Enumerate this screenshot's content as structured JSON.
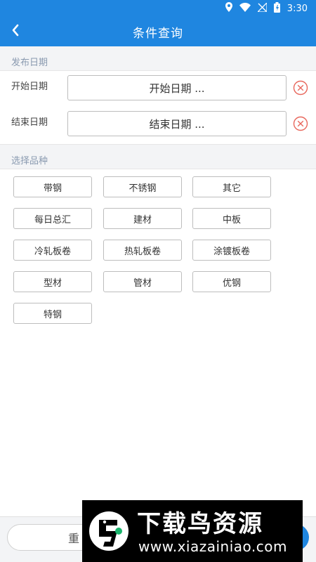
{
  "status_bar": {
    "time": "3:30",
    "icons": [
      "location-icon",
      "wifi-icon",
      "no-signal-icon",
      "battery-icon"
    ]
  },
  "app_bar": {
    "title": "条件查询",
    "back_icon": "chevron-left-icon"
  },
  "date_section": {
    "header": "发布日期",
    "start_label": "开始日期",
    "start_placeholder": "开始日期 ...",
    "end_label": "结束日期",
    "end_placeholder": "结束日期 ..."
  },
  "variety_section": {
    "header": "选择品种",
    "items": [
      "带钢",
      "不锈钢",
      "其它",
      "每日总汇",
      "建材",
      "中板",
      "冷轧板卷",
      "热轧板卷",
      "涂镀板卷",
      "型材",
      "管材",
      "优钢",
      "特钢"
    ]
  },
  "actions": {
    "reset_label": "重"
  },
  "watermark": {
    "title": "下载鸟资源",
    "url": "www.xiazainiao.com"
  },
  "colors": {
    "primary": "#1f86e0",
    "clear_icon": "#e8675c",
    "section_text": "#8a9ab0"
  }
}
